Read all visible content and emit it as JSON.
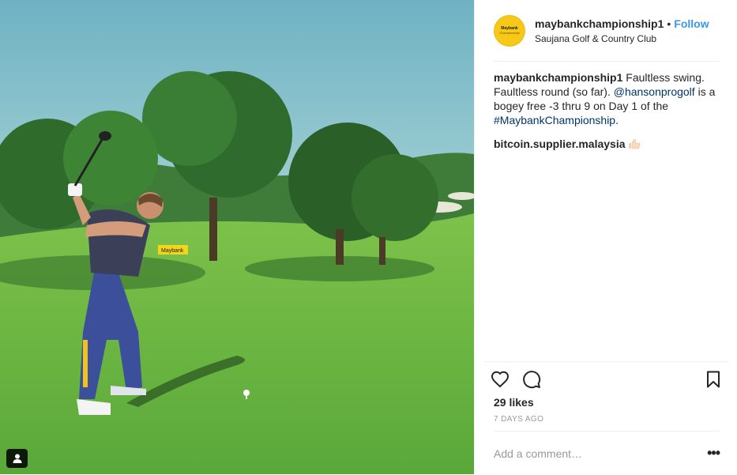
{
  "photo": {
    "alt_icon": "tagged-user-icon",
    "sign_text": "Maybank"
  },
  "header": {
    "avatar_line1": "Maybank",
    "avatar_line2": "Championship",
    "username": "maybankchampionship1",
    "separator": "•",
    "follow_label": "Follow",
    "location": "Saujana Golf & Country Club"
  },
  "caption": {
    "username": "maybankchampionship1",
    "text_part1": " Faultless swing. Faultless round (so far). ",
    "mention": "@hansonprogolf",
    "text_part2": " is a bogey free -3 thru 9 on Day 1 of the ",
    "hashtag": "#MaybankChampionship",
    "text_part3": "."
  },
  "comments": [
    {
      "username": "bitcoin.supplier.malaysia",
      "emoji": "thumbs-up-light-skin"
    }
  ],
  "actions": {
    "like_icon": "heart-outline-icon",
    "comment_icon": "speech-bubble-icon",
    "save_icon": "bookmark-icon"
  },
  "likes": "29 likes",
  "timestamp": "7 DAYS AGO",
  "add_comment": {
    "placeholder": "Add a comment…",
    "more": "•••"
  },
  "colors": {
    "follow": "#3897f0",
    "link": "#003569",
    "muted": "#999999",
    "border": "#efefef"
  }
}
